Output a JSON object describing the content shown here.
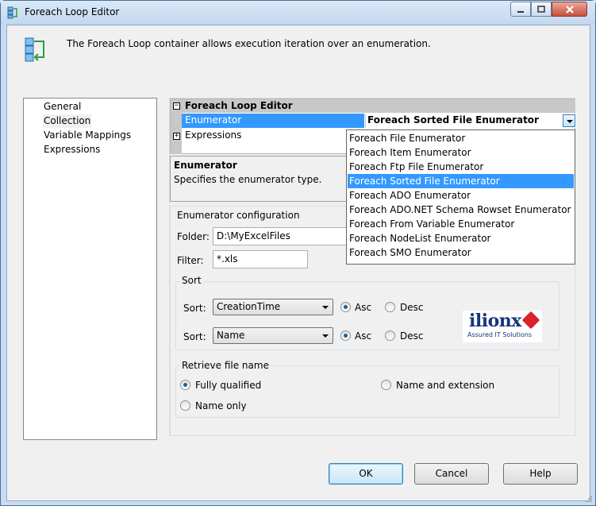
{
  "window": {
    "title": "Foreach Loop Editor"
  },
  "header": {
    "description": "The Foreach Loop container allows execution iteration over an enumeration."
  },
  "nav": {
    "items": [
      "General",
      "Collection",
      "Variable Mappings",
      "Expressions"
    ],
    "selected": "Collection"
  },
  "property_grid": {
    "category": "Foreach Loop Editor",
    "enumerator_label": "Enumerator",
    "enumerator_value": "Foreach Sorted File Enumerator",
    "expressions_label": "Expressions"
  },
  "dropdown": {
    "options": [
      "Foreach File Enumerator",
      "Foreach Item Enumerator",
      "Foreach Ftp File Enumerator",
      "Foreach Sorted File Enumerator",
      "Foreach ADO Enumerator",
      "Foreach ADO.NET Schema Rowset Enumerator",
      "Foreach From Variable Enumerator",
      "Foreach NodeList Enumerator",
      "Foreach SMO Enumerator"
    ],
    "selected_index": 3
  },
  "description_box": {
    "title": "Enumerator",
    "text": "Specifies the enumerator type."
  },
  "config": {
    "title": "Enumerator configuration",
    "folder_label": "Folder:",
    "folder_value": "D:\\MyExcelFiles",
    "filter_label": "Filter:",
    "filter_value": "*.xls",
    "sort_group_title": "Sort",
    "sort1_label": "Sort:",
    "sort1_value": "CreationTime",
    "sort1_asc": "Asc",
    "sort1_desc": "Desc",
    "sort2_label": "Sort:",
    "sort2_value": "Name",
    "sort2_asc": "Asc",
    "sort2_desc": "Desc",
    "retrieve_group_title": "Retrieve file name",
    "opt_fully_qualified": "Fully qualified",
    "opt_name_ext": "Name and extension",
    "opt_name_only": "Name only"
  },
  "logo": {
    "word": "ilionx",
    "tagline": "Assured IT Solutions"
  },
  "buttons": {
    "ok": "OK",
    "cancel": "Cancel",
    "help": "Help"
  }
}
